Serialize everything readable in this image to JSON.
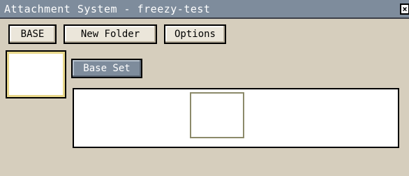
{
  "window": {
    "title": "Attachment System - freezy-test"
  },
  "toolbar": {
    "base_label": "BASE",
    "new_folder_label": "New Folder",
    "options_label": "Options"
  },
  "set": {
    "label": "Base Set"
  },
  "frames": [
    {
      "selected": false
    },
    {
      "selected": false
    },
    {
      "selected": true
    },
    {
      "selected": false
    },
    {
      "selected": false
    }
  ],
  "colors": {
    "titlebar": "#7e8c9c",
    "background": "#d6cebd",
    "face": "#c96b5c",
    "face_dark": "#7a2626",
    "mouth": "#4a0b0b"
  },
  "icons": {
    "close": "close-icon",
    "sprite": "bald-angry-head-sprite"
  }
}
